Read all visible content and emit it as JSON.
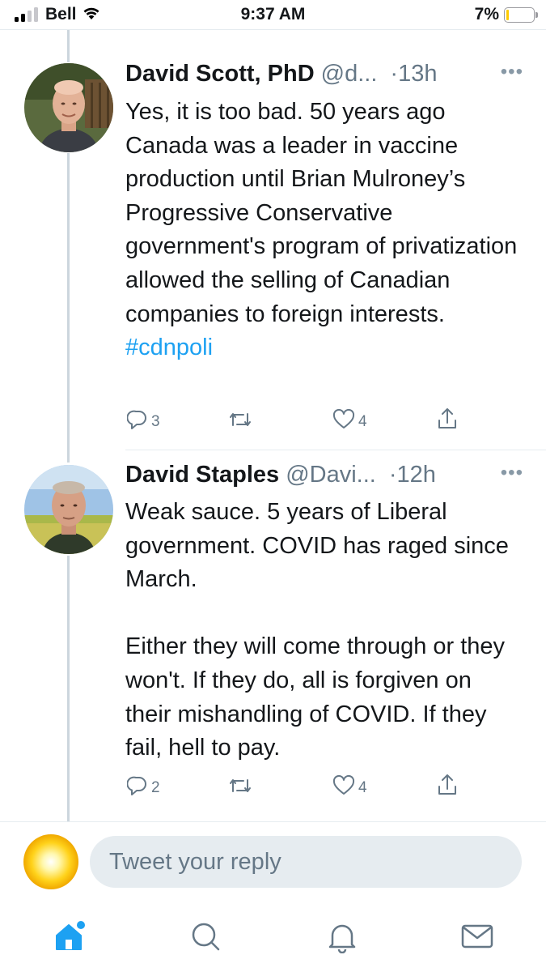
{
  "status_bar": {
    "carrier": "Bell",
    "time": "9:37 AM",
    "battery_percent": "7%",
    "battery_level": 0.07
  },
  "tweets": [
    {
      "name": "David Scott, PhD",
      "handle": "@d...",
      "time": "·13h",
      "text": "Yes, it is too bad. 50 years ago Canada was a leader in vaccine production until Brian Mulroney’s Progressive Conservative government's program of privatization allowed the selling of Canadian companies to foreign interests.",
      "hashtag": "#cdnpoli",
      "replies": "3",
      "likes": "4"
    },
    {
      "name": "David Staples",
      "handle": "@Davi...",
      "time": "·12h",
      "text": "Weak sauce. 5 years of Liberal government. COVID has raged since March.\n\nEither they will come through or they won't. If they do, all is forgiven on their mishandling of COVID. If they fail, hell to pay.",
      "replies": "2",
      "likes": "4"
    }
  ],
  "reply": {
    "placeholder": "Tweet your reply"
  },
  "colors": {
    "accent": "#1da1f2",
    "muted": "#657786",
    "text": "#14171a",
    "divider": "#e6ecf0"
  },
  "tab_bar": {
    "tabs": [
      "home-icon",
      "search-icon",
      "notifications-icon",
      "messages-icon"
    ]
  }
}
